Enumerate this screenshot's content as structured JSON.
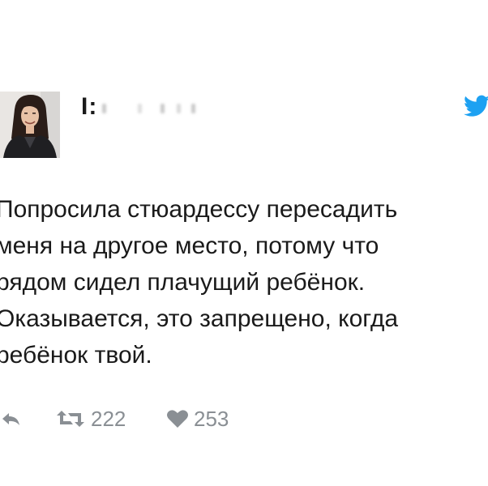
{
  "tweet": {
    "author_name": "I:",
    "text_lines": [
      "Попросила стюардессу пересадить",
      "меня на другое место, потому что",
      "рядом сидел плачущий ребёнок.",
      "Оказывается, это запрещено, когда",
      "ребёнок твой."
    ],
    "retweet_count": "222",
    "like_count": "253"
  },
  "icons": {
    "brand": "twitter-bird-icon",
    "reply": "reply-icon",
    "retweet": "retweet-icon",
    "like": "heart-icon"
  },
  "colors": {
    "twitter_blue": "#1da1f2",
    "action_gray": "#8a8f94",
    "text": "#1a1a1a"
  }
}
